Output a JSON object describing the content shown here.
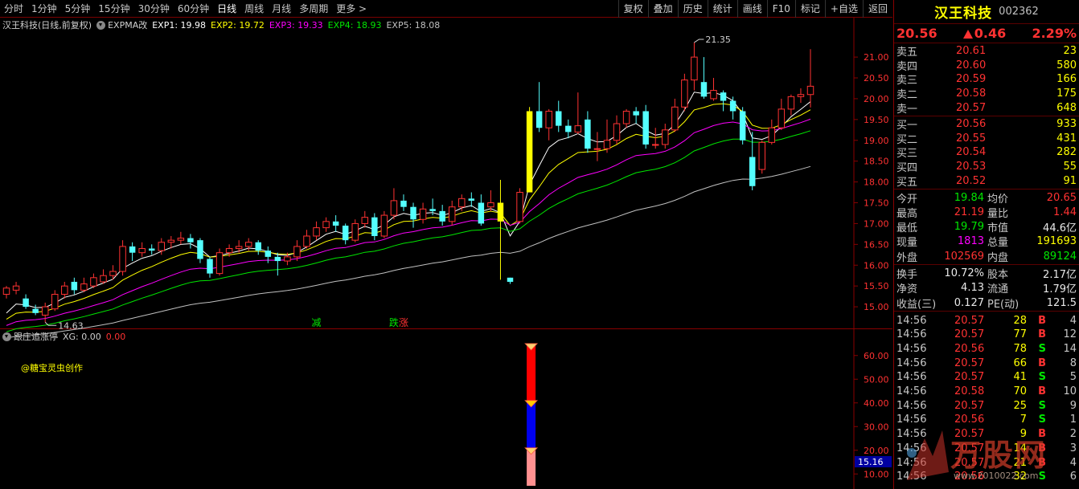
{
  "toolbar": {
    "periods": [
      "分时",
      "1分钟",
      "5分钟",
      "15分钟",
      "30分钟",
      "60分钟",
      "日线",
      "周线",
      "月线",
      "多周期",
      "更多 >"
    ],
    "active_period": "日线",
    "tools": [
      "复权",
      "叠加",
      "历史",
      "统计",
      "画线",
      "F10",
      "标记",
      "+自选",
      "返回"
    ]
  },
  "main_header": {
    "stock_label": "汉王科技(日线,前复权)",
    "indicator": "EXPMA改",
    "exps": [
      {
        "label": "EXP1: 19.98",
        "color": "#ffffff"
      },
      {
        "label": "EXP2: 19.72",
        "color": "#ffff00"
      },
      {
        "label": "EXP3: 19.33",
        "color": "#ff00ff"
      },
      {
        "label": "EXP4: 18.93",
        "color": "#00e600"
      },
      {
        "label": "EXP5: 18.08",
        "color": "#c0c0c0"
      }
    ]
  },
  "chart_data": [
    {
      "type": "candlestick",
      "title": "汉王科技(日线,前复权)",
      "ylim": [
        14.5,
        21.6
      ],
      "y_ticks": [
        "21.00",
        "20.50",
        "20.00",
        "19.50",
        "19.00",
        "18.50",
        "18.00",
        "17.50",
        "17.00",
        "16.50",
        "16.00",
        "15.50",
        "15.00"
      ],
      "annotations": {
        "high_label": "21.35",
        "low_label": "14.63"
      },
      "signals": [
        {
          "text": "减",
          "color": "#00e600",
          "index": 32
        },
        {
          "text": "跌",
          "color": "#00e600",
          "index": 40
        },
        {
          "text": "涨",
          "color": "#ff3232",
          "index": 41
        }
      ],
      "candles": [
        [
          15.3,
          15.45,
          15.5,
          15.2
        ],
        [
          15.4,
          15.5,
          15.6,
          15.3
        ],
        [
          15.2,
          15.0,
          15.3,
          14.95
        ],
        [
          14.95,
          14.85,
          15.05,
          14.8
        ],
        [
          14.8,
          15.0,
          15.1,
          14.63
        ],
        [
          14.95,
          15.3,
          15.4,
          14.9
        ],
        [
          15.3,
          15.5,
          15.6,
          15.2
        ],
        [
          15.6,
          15.4,
          15.7,
          15.3
        ],
        [
          15.4,
          15.55,
          15.7,
          15.35
        ],
        [
          15.5,
          15.7,
          15.8,
          15.45
        ],
        [
          15.6,
          15.75,
          15.9,
          15.55
        ],
        [
          15.75,
          15.85,
          16.0,
          15.65
        ],
        [
          15.85,
          16.45,
          16.6,
          15.75
        ],
        [
          16.45,
          16.3,
          16.55,
          16.1
        ],
        [
          16.3,
          16.4,
          16.55,
          16.2
        ],
        [
          16.4,
          16.35,
          16.5,
          16.25
        ],
        [
          16.35,
          16.55,
          16.65,
          16.25
        ],
        [
          16.55,
          16.6,
          16.7,
          16.4
        ],
        [
          16.6,
          16.65,
          16.8,
          16.5
        ],
        [
          16.65,
          16.55,
          16.75,
          16.4
        ],
        [
          16.6,
          16.15,
          16.65,
          16.05
        ],
        [
          16.15,
          15.8,
          16.2,
          15.7
        ],
        [
          15.8,
          16.3,
          16.4,
          15.75
        ],
        [
          16.3,
          16.4,
          16.5,
          16.2
        ],
        [
          16.4,
          16.45,
          16.6,
          16.3
        ],
        [
          16.45,
          16.55,
          16.65,
          16.35
        ],
        [
          16.55,
          16.35,
          16.6,
          16.25
        ],
        [
          16.35,
          16.2,
          16.45,
          16.05
        ],
        [
          16.2,
          16.1,
          16.3,
          15.75
        ],
        [
          16.1,
          16.2,
          16.3,
          16.0
        ],
        [
          16.2,
          16.45,
          16.6,
          16.1
        ],
        [
          16.45,
          16.7,
          16.85,
          16.4
        ],
        [
          16.7,
          16.9,
          17.05,
          16.6
        ],
        [
          16.9,
          17.05,
          17.15,
          16.8
        ],
        [
          17.05,
          16.95,
          17.2,
          16.8
        ],
        [
          16.95,
          16.6,
          17.0,
          16.5
        ],
        [
          16.6,
          17.0,
          17.1,
          16.55
        ],
        [
          17.0,
          17.15,
          17.3,
          16.9
        ],
        [
          17.15,
          16.7,
          17.25,
          16.6
        ],
        [
          16.7,
          17.2,
          17.3,
          16.65
        ],
        [
          17.2,
          17.55,
          17.85,
          17.1
        ],
        [
          17.55,
          17.4,
          17.7,
          17.3
        ],
        [
          17.4,
          17.1,
          17.5,
          16.9
        ],
        [
          17.1,
          17.35,
          17.5,
          17.0
        ],
        [
          17.35,
          17.3,
          17.6,
          17.2
        ],
        [
          17.3,
          17.05,
          17.45,
          16.95
        ],
        [
          17.05,
          17.4,
          17.55,
          16.95
        ],
        [
          17.4,
          17.6,
          17.7,
          17.3
        ],
        [
          17.6,
          17.55,
          17.75,
          17.4
        ],
        [
          17.5,
          17.0,
          17.7,
          16.95
        ],
        [
          17.4,
          17.5,
          17.8,
          17.3
        ],
        [
          17.5,
          17.05,
          18.05,
          15.65
        ],
        [
          15.7,
          15.6,
          15.7,
          15.55
        ],
        [
          17.05,
          17.75,
          17.85,
          17.0
        ],
        [
          17.75,
          19.7,
          19.8,
          17.75
        ],
        [
          19.7,
          19.3,
          20.4,
          19.2
        ],
        [
          19.3,
          19.7,
          19.75,
          19.0
        ],
        [
          19.7,
          19.35,
          19.95,
          19.2
        ],
        [
          19.35,
          19.2,
          19.5,
          19.05
        ],
        [
          19.2,
          19.35,
          20.15,
          19.15
        ],
        [
          19.5,
          18.8,
          19.7,
          18.7
        ],
        [
          18.8,
          18.8,
          19.2,
          18.5
        ],
        [
          18.8,
          19.0,
          19.5,
          18.7
        ],
        [
          19.0,
          19.4,
          19.6,
          18.9
        ],
        [
          19.4,
          19.7,
          19.75,
          19.3
        ],
        [
          19.7,
          19.6,
          19.8,
          19.4
        ],
        [
          19.7,
          18.9,
          19.85,
          18.8
        ],
        [
          18.9,
          18.9,
          19.3,
          18.8
        ],
        [
          18.9,
          19.25,
          19.4,
          18.8
        ],
        [
          19.25,
          19.8,
          20.0,
          19.2
        ],
        [
          19.8,
          20.45,
          20.6,
          19.7
        ],
        [
          20.45,
          21.0,
          21.35,
          20.2
        ],
        [
          20.4,
          20.05,
          21.0,
          20.0
        ],
        [
          20.0,
          20.2,
          20.5,
          19.95
        ],
        [
          20.15,
          19.95,
          20.2,
          19.7
        ],
        [
          19.95,
          19.7,
          20.05,
          19.5
        ],
        [
          19.7,
          19.0,
          19.8,
          18.9
        ],
        [
          18.6,
          17.9,
          19.2,
          17.8
        ],
        [
          18.3,
          18.95,
          19.0,
          18.2
        ],
        [
          18.95,
          19.3,
          19.5,
          18.9
        ],
        [
          19.3,
          19.75,
          20.0,
          19.25
        ],
        [
          19.75,
          20.05,
          20.1,
          19.6
        ],
        [
          20.05,
          20.1,
          20.25,
          19.9
        ],
        [
          20.1,
          20.3,
          21.19,
          19.79
        ]
      ],
      "ema_series": [
        {
          "name": "EXP1",
          "period": 5,
          "color": "#ffffff"
        },
        {
          "name": "EXP2",
          "period": 10,
          "color": "#ffff00"
        },
        {
          "name": "EXP3",
          "period": 20,
          "color": "#ff00ff"
        },
        {
          "name": "EXP4",
          "period": 30,
          "color": "#00e600"
        },
        {
          "name": "EXP5",
          "period": 60,
          "color": "#c0c0c0"
        }
      ]
    },
    {
      "type": "bar",
      "title": "跟庄追涨停",
      "ylim": [
        5,
        65
      ],
      "y_ticks": [
        "60.00",
        "50.00",
        "40.00",
        "30.00",
        "20.00",
        "10.00"
      ],
      "current_value_label": "15.16",
      "segments": [
        {
          "from": 40,
          "to": 64,
          "color": "#ff0000"
        },
        {
          "from": 20,
          "to": 40,
          "color": "#0000ee"
        },
        {
          "from": 5,
          "to": 20,
          "color": "#ff9090"
        }
      ],
      "markers": [
        64,
        40,
        20
      ]
    }
  ],
  "sub_header": {
    "name": "跟庄追涨停",
    "xg_label": "XG: 0.00",
    "value": "0.00",
    "credit": "@糖宝灵虫创作"
  },
  "quote": {
    "name": "汉王科技",
    "code": "002362",
    "price": "20.56",
    "change": "0.46",
    "pct": "2.29%",
    "asks": [
      {
        "label": "卖五",
        "price": "20.61",
        "vol": "23"
      },
      {
        "label": "卖四",
        "price": "20.60",
        "vol": "580"
      },
      {
        "label": "卖三",
        "price": "20.59",
        "vol": "166"
      },
      {
        "label": "卖二",
        "price": "20.58",
        "vol": "175"
      },
      {
        "label": "卖一",
        "price": "20.57",
        "vol": "648"
      }
    ],
    "bids": [
      {
        "label": "买一",
        "price": "20.56",
        "vol": "933"
      },
      {
        "label": "买二",
        "price": "20.55",
        "vol": "431"
      },
      {
        "label": "买三",
        "price": "20.54",
        "vol": "282"
      },
      {
        "label": "买四",
        "price": "20.53",
        "vol": "55"
      },
      {
        "label": "买五",
        "price": "20.52",
        "vol": "91"
      }
    ],
    "stats1": [
      {
        "l": "今开",
        "v": "19.84",
        "vc": "green",
        "l2": "均价",
        "v2": "20.65",
        "v2c": "red"
      },
      {
        "l": "最高",
        "v": "21.19",
        "vc": "red",
        "l2": "量比",
        "v2": "1.44",
        "v2c": "red"
      },
      {
        "l": "最低",
        "v": "19.79",
        "vc": "green",
        "l2": "市值",
        "v2": "44.6亿",
        "v2c": "white"
      },
      {
        "l": "现量",
        "v": "1813",
        "vc": "magenta",
        "l2": "总量",
        "v2": "191693",
        "v2c": "yellow"
      },
      {
        "l": "外盘",
        "v": "102569",
        "vc": "red",
        "l2": "内盘",
        "v2": "89124",
        "v2c": "green"
      }
    ],
    "stats2": [
      {
        "l": "换手",
        "v": "10.72%",
        "vc": "white",
        "l2": "股本",
        "v2": "2.17亿",
        "v2c": "white"
      },
      {
        "l": "净资",
        "v": "4.13",
        "vc": "white",
        "l2": "流通",
        "v2": "1.79亿",
        "v2c": "white"
      },
      {
        "l": "收益(三)",
        "v": "0.127",
        "vc": "white",
        "l2": "PE(动)",
        "v2": "121.5",
        "v2c": "white"
      }
    ],
    "ticks": [
      {
        "t": "14:56",
        "p": "20.57",
        "q": "28",
        "d": "B",
        "n": "4"
      },
      {
        "t": "14:56",
        "p": "20.57",
        "q": "77",
        "d": "B",
        "n": "12"
      },
      {
        "t": "14:56",
        "p": "20.56",
        "q": "78",
        "d": "S",
        "n": "14"
      },
      {
        "t": "14:56",
        "p": "20.57",
        "q": "66",
        "d": "B",
        "n": "8"
      },
      {
        "t": "14:56",
        "p": "20.57",
        "q": "41",
        "d": "S",
        "n": "5"
      },
      {
        "t": "14:56",
        "p": "20.58",
        "q": "70",
        "d": "B",
        "n": "10"
      },
      {
        "t": "14:56",
        "p": "20.57",
        "q": "25",
        "d": "S",
        "n": "9"
      },
      {
        "t": "14:56",
        "p": "20.56",
        "q": "7",
        "d": "S",
        "n": "1"
      },
      {
        "t": "14:56",
        "p": "20.57",
        "q": "9",
        "d": "B",
        "n": "2"
      },
      {
        "t": "14:56",
        "p": "20.57",
        "q": "14",
        "d": "B",
        "n": "3"
      },
      {
        "t": "14:56",
        "p": "20.57",
        "q": "21",
        "d": "B",
        "n": "4"
      },
      {
        "t": "14:56",
        "p": "20.56",
        "q": "32",
        "d": "S",
        "n": "6"
      }
    ]
  },
  "watermark": {
    "text": "万股网",
    "url": "www.2010022.com"
  }
}
